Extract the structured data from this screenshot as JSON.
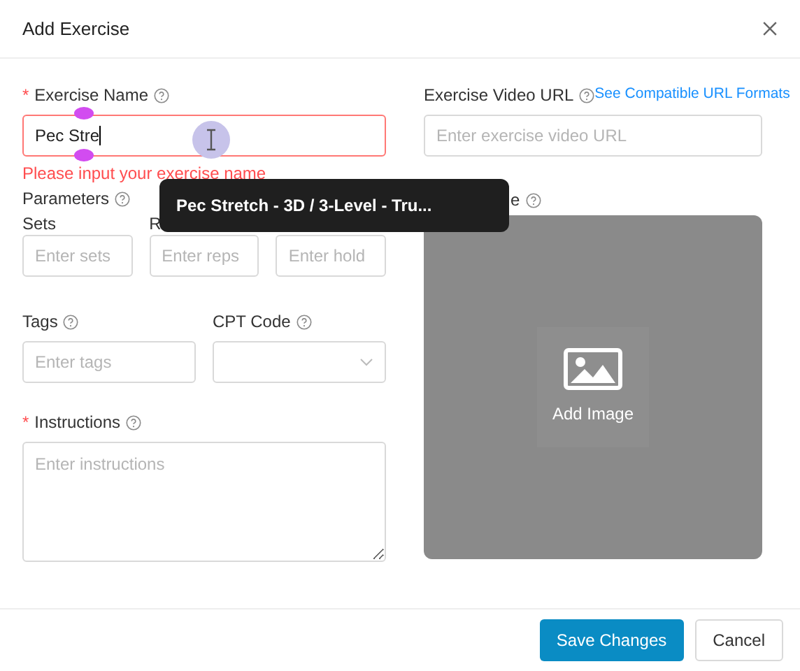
{
  "dialog": {
    "title": "Add Exercise"
  },
  "required_mark": "*",
  "exercise_name": {
    "label": "Exercise Name",
    "required": true,
    "value": "Pec Stre",
    "error": "Please input your exercise name"
  },
  "video_url": {
    "label": "Exercise Video URL",
    "required": false,
    "link": "See Compatible URL Formats",
    "placeholder": "Enter exercise video URL"
  },
  "parameters": {
    "label": "Parameters",
    "fields": [
      {
        "label": "Sets",
        "placeholder": "Enter sets"
      },
      {
        "label": "R",
        "placeholder": "Enter reps"
      },
      {
        "placeholder": "Enter hold"
      }
    ]
  },
  "image": {
    "label": "e",
    "action": "Add Image"
  },
  "tags": {
    "label": "Tags",
    "required": false,
    "placeholder": "Enter tags"
  },
  "cpt_code": {
    "label": "CPT Code",
    "required": false
  },
  "instructions": {
    "label": "Instructions",
    "required": true,
    "placeholder": "Enter instructions"
  },
  "suggestion_tooltip": {
    "text": "Pec Stretch - 3D / 3-Level - Tru..."
  },
  "buttons": [
    {
      "label": "Save Changes",
      "kind": "primary"
    },
    {
      "label": "Cancel",
      "kind": "default"
    }
  ]
}
